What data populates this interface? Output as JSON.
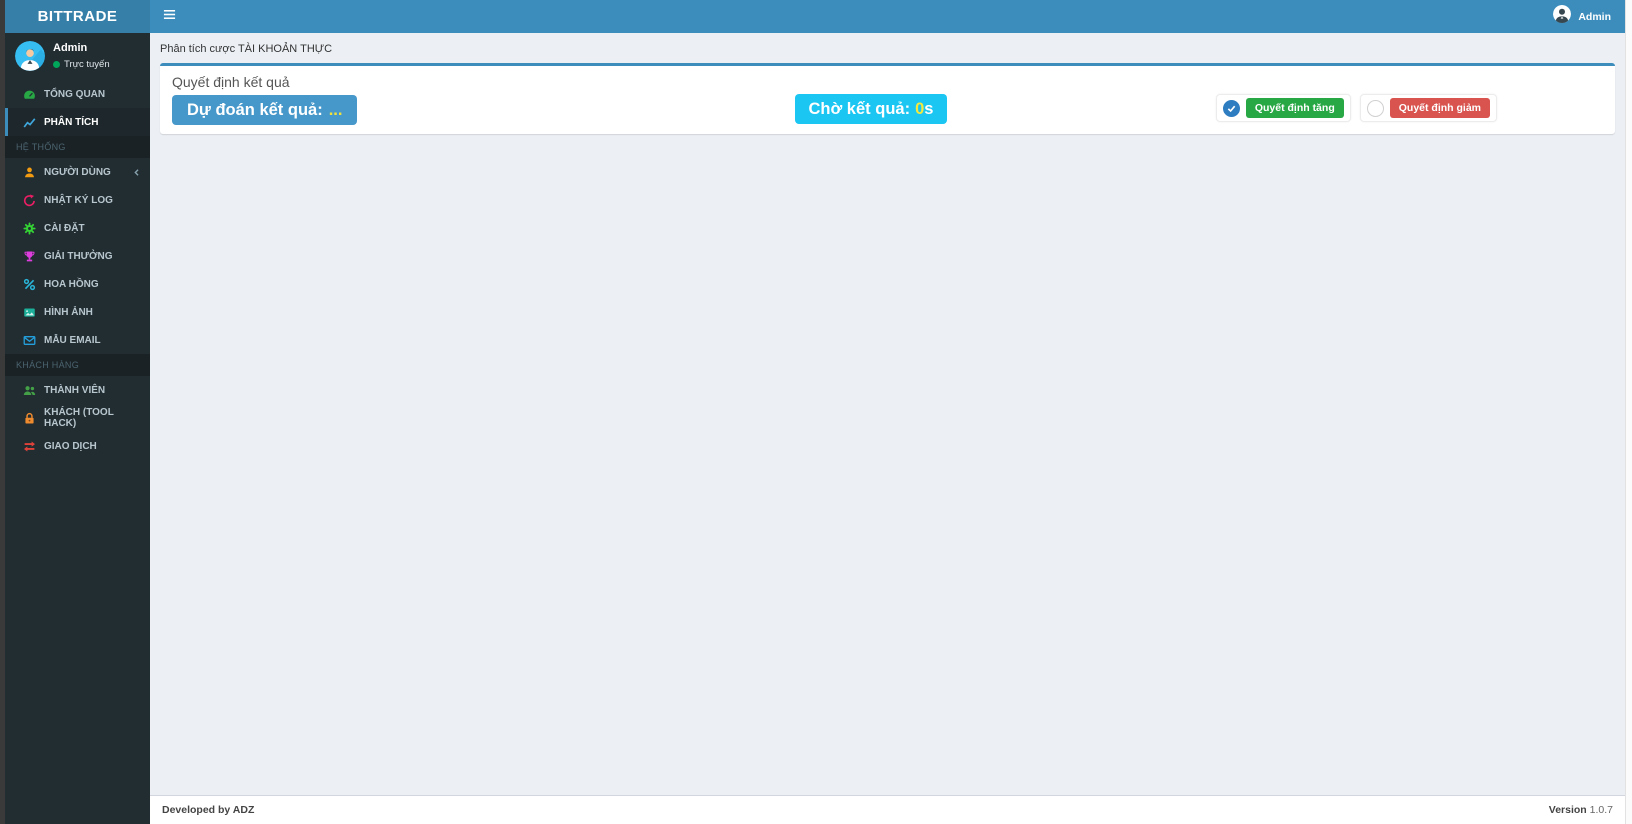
{
  "app": {
    "brand": "BITTRADE"
  },
  "topbar": {
    "user_label": "Admin"
  },
  "sidebar": {
    "user": {
      "name": "Admin",
      "status": "Trực tuyến"
    },
    "items_top": [
      {
        "label": "TỔNG QUAN",
        "icon": "dashboard-icon",
        "active": false
      },
      {
        "label": "PHÂN TÍCH",
        "icon": "chart-line-icon",
        "active": true
      }
    ],
    "sections": [
      {
        "title": "HỆ THỐNG",
        "items": [
          {
            "label": "NGƯỜI DÙNG",
            "icon": "user-icon",
            "has_submenu": true
          },
          {
            "label": "NHẬT KÝ LOG",
            "icon": "history-icon"
          },
          {
            "label": "CÀI ĐẶT",
            "icon": "gear-icon"
          },
          {
            "label": "GIẢI THƯỞNG",
            "icon": "trophy-icon"
          },
          {
            "label": "HOA HỒNG",
            "icon": "percent-icon"
          },
          {
            "label": "HÌNH ẢNH",
            "icon": "image-icon"
          },
          {
            "label": "MẪU EMAIL",
            "icon": "envelope-icon"
          }
        ]
      },
      {
        "title": "KHÁCH HÀNG",
        "items": [
          {
            "label": "THÀNH VIÊN",
            "icon": "users-icon"
          },
          {
            "label": "KHÁCH (TOOL HACK)",
            "icon": "lock-icon"
          },
          {
            "label": "GIAO DỊCH",
            "icon": "exchange-icon"
          }
        ]
      }
    ]
  },
  "content": {
    "page_title": "Phân tích cược TÀI KHOẢN THỰC",
    "box": {
      "title": "Quyết định kết quả",
      "predict_button": {
        "label": "Dự đoán kết quả:",
        "value": "..."
      },
      "wait_badge": {
        "label": "Chờ kết quả:",
        "value": "0",
        "unit": "s"
      },
      "decision_up": {
        "label": "Quyết định tăng",
        "checked": true
      },
      "decision_down": {
        "label": "Quyết định giảm",
        "checked": false
      }
    }
  },
  "footer": {
    "developed_by": "Developed by ADZ",
    "version_label": "Version",
    "version_value": "1.0.7"
  },
  "colors": {
    "navbar": "#3c8dbc",
    "logo_bg": "#367fa9",
    "sidebar_bg": "#222d32",
    "active_border": "#3c8dbc",
    "content_bg": "#ecf0f5",
    "predict_blue": "#4697ca",
    "wait_cyan": "#1bc6f2",
    "success_green": "#28a745",
    "danger_red": "#d9534f",
    "highlight_yellow": "#f3e23a",
    "online_green": "#00a65a",
    "icon_dashboard": "#28a745",
    "icon_chart": "#3fa7dc",
    "icon_user": "#f39c12",
    "icon_history": "#e91e63",
    "icon_gear": "#35d435",
    "icon_trophy": "#dd3ddd",
    "icon_percent": "#29b5d8",
    "icon_image": "#1caf9a",
    "icon_envelope": "#249fdb",
    "icon_users": "#43a047",
    "icon_lock": "#ef8b2f",
    "icon_exchange": "#e0423a"
  }
}
